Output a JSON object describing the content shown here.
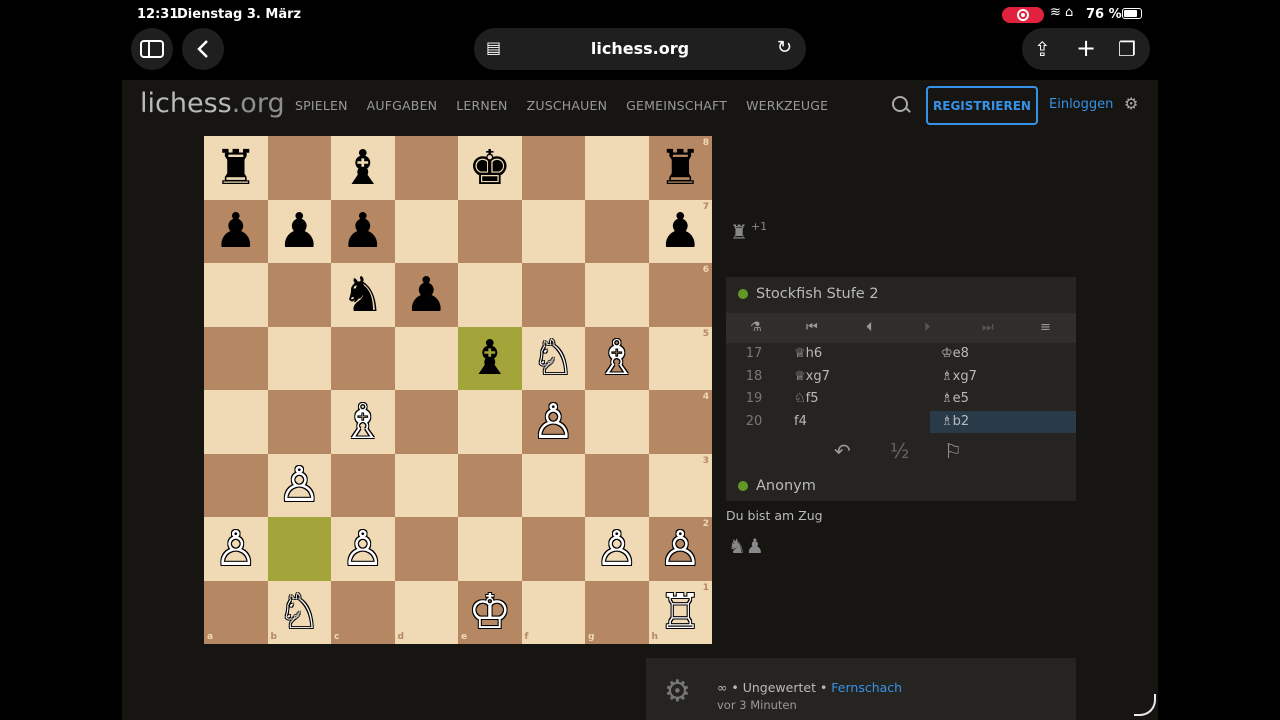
{
  "statusbar": {
    "time": "12:31",
    "date": "Dienstag 3. März",
    "battery": "76 %"
  },
  "browser": {
    "url": "lichess.org"
  },
  "site": {
    "logo_main": "lichess",
    "logo_suffix": ".org",
    "nav": [
      "SPIELEN",
      "AUFGABEN",
      "LERNEN",
      "ZUSCHAUEN",
      "GEMEINSCHAFT",
      "WERKZEUGE"
    ],
    "register": "REGISTRIEREN",
    "login": "Einloggen"
  },
  "board": {
    "files": [
      "a",
      "b",
      "c",
      "d",
      "e",
      "f",
      "g",
      "h"
    ],
    "ranks": [
      "8",
      "7",
      "6",
      "5",
      "4",
      "3",
      "2",
      "1"
    ],
    "rows": [
      [
        "♜",
        "",
        "♝",
        "",
        "♚",
        "",
        "",
        "♜"
      ],
      [
        "♟",
        "♟",
        "♟",
        "",
        "",
        "",
        "",
        "♟"
      ],
      [
        "",
        "",
        "♞",
        "♟",
        "",
        "",
        "",
        ""
      ],
      [
        "",
        "",
        "",
        "",
        "♝",
        "♘",
        "♗",
        ""
      ],
      [
        "",
        "",
        "♗",
        "",
        "",
        "♙",
        "",
        ""
      ],
      [
        "",
        "♙",
        "",
        "",
        "",
        "",
        "",
        ""
      ],
      [
        "♙",
        "",
        "♙",
        "",
        "",
        "",
        "♙",
        "♙"
      ],
      [
        "",
        "♘",
        "",
        "",
        "♔",
        "",
        "",
        "♖"
      ]
    ],
    "colors": [
      [
        "b",
        "",
        "b",
        "",
        "b",
        "",
        "",
        "b"
      ],
      [
        "b",
        "b",
        "b",
        "",
        "",
        "",
        "",
        "b"
      ],
      [
        "",
        "",
        "b",
        "b",
        "",
        "",
        "",
        ""
      ],
      [
        "",
        "",
        "",
        "",
        "b",
        "w",
        "w",
        ""
      ],
      [
        "",
        "",
        "w",
        "",
        "",
        "w",
        "",
        ""
      ],
      [
        "",
        "w",
        "",
        "",
        "",
        "",
        "",
        ""
      ],
      [
        "w",
        "",
        "w",
        "",
        "",
        "",
        "w",
        "w"
      ],
      [
        "",
        "w",
        "",
        "",
        "w",
        "",
        "",
        "w"
      ]
    ],
    "highlights": [
      [
        3,
        4
      ],
      [
        6,
        1
      ]
    ]
  },
  "material_top": {
    "icon": "♜",
    "diff": "+1"
  },
  "opponent": "Stockfish Stufe 2",
  "moves": [
    {
      "num": "17",
      "white": "♕h6",
      "black": "♔e8"
    },
    {
      "num": "18",
      "white": "♕xg7",
      "black": "♗xg7"
    },
    {
      "num": "19",
      "white": "♘f5",
      "black": "♗e5"
    },
    {
      "num": "20",
      "white": "f4",
      "black": "♗b2"
    }
  ],
  "actions": {
    "takeback": "↶",
    "draw": "½",
    "resign": "⚐"
  },
  "player": "Anonym",
  "turn_text": "Du bist am Zug",
  "material_bottom": "♞♟",
  "game_info": {
    "prefix": "∞ • Ungewertet • ",
    "mode": "Fernschach",
    "time": "vor 3 Minuten"
  },
  "accent_colors": {
    "link": "#3692e7",
    "online": "#629924",
    "highlight": "#a3a43a"
  }
}
